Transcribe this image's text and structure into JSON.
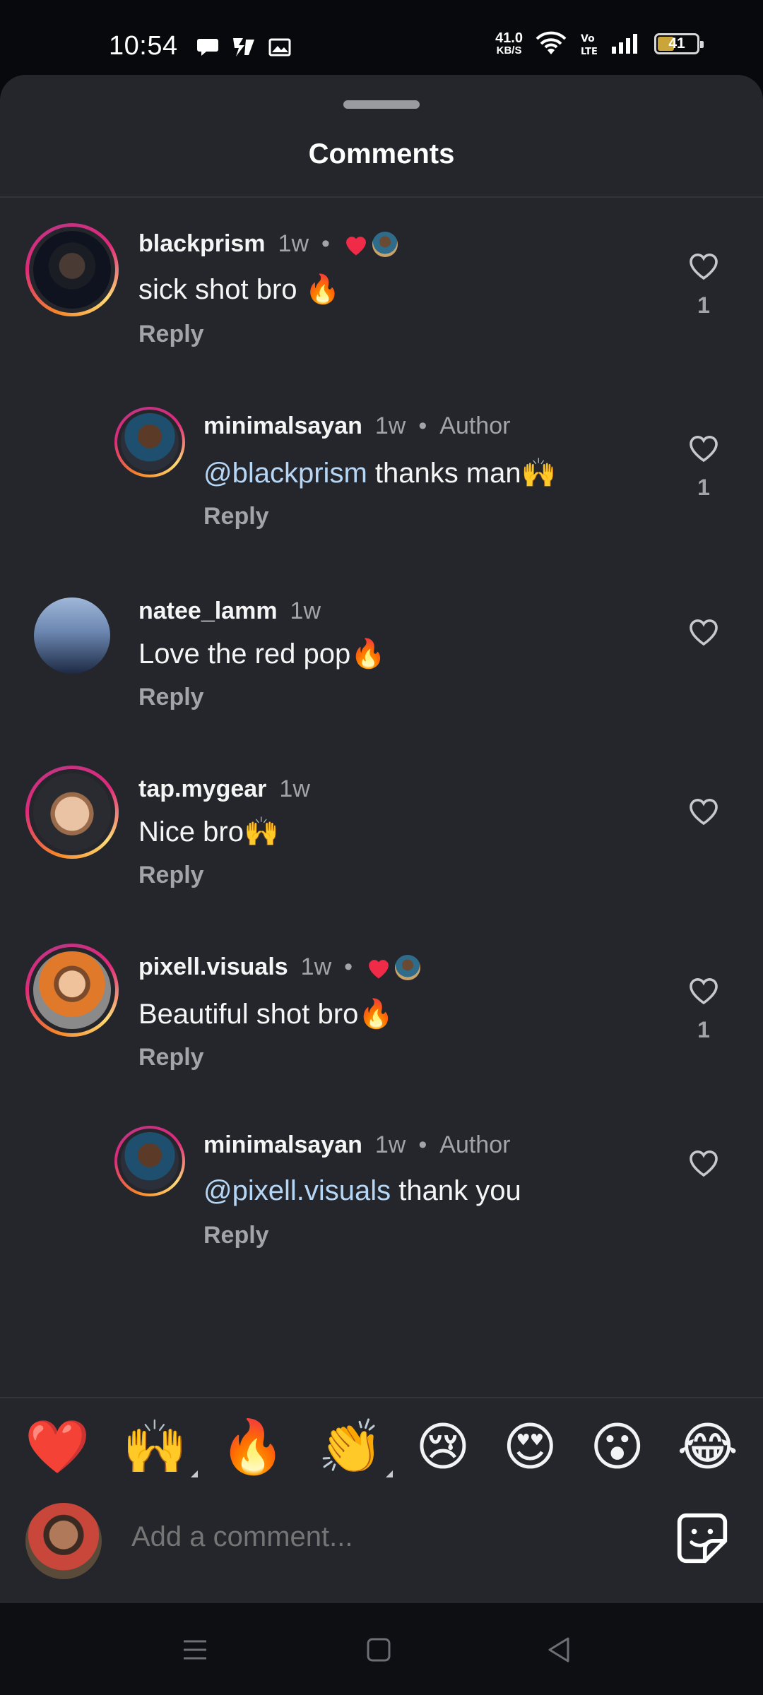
{
  "status_bar": {
    "time": "10:54",
    "net_speed_value": "41.0",
    "net_speed_unit": "KB/S",
    "network_label": "Vo LTE",
    "battery": "41"
  },
  "sheet": {
    "title": "Comments"
  },
  "comments": [
    {
      "username": "blackprism",
      "time": "1w",
      "dot": "•",
      "author_liked": true,
      "text": "sick shot bro 🔥",
      "reply": "Reply",
      "likes": "1",
      "accent": "#ef2b48"
    },
    {
      "username": "minimalsayan",
      "time": "1w",
      "dot": "•",
      "badge": "Author",
      "mention": "@blackprism",
      "text": " thanks man🙌",
      "reply": "Reply",
      "likes": "1"
    },
    {
      "username": "natee_lamm",
      "time": "1w",
      "text": "Love the red pop🔥",
      "reply": "Reply"
    },
    {
      "username": "tap.mygear",
      "time": "1w",
      "text": "Nice bro🙌",
      "reply": "Reply"
    },
    {
      "username": "pixell.visuals",
      "time": "1w",
      "dot": "•",
      "author_liked": true,
      "text": "Beautiful shot bro🔥",
      "reply": "Reply",
      "likes": "1"
    },
    {
      "username": "minimalsayan",
      "time": "1w",
      "dot": "•",
      "badge": "Author",
      "mention": "@pixell.visuals",
      "text": " thank you",
      "reply": "Reply"
    }
  ],
  "emoji_bar": [
    "❤️",
    "🙌",
    "🔥",
    "👏",
    "😢",
    "😍",
    "😮",
    "😂"
  ],
  "compose": {
    "placeholder": "Add a comment..."
  },
  "icons": {
    "heart": "heart-outline-icon",
    "liked": "red-heart-icon",
    "sticker": "sticker-icon",
    "nav": [
      "menu-icon",
      "home-square-icon",
      "back-triangle-icon"
    ]
  }
}
